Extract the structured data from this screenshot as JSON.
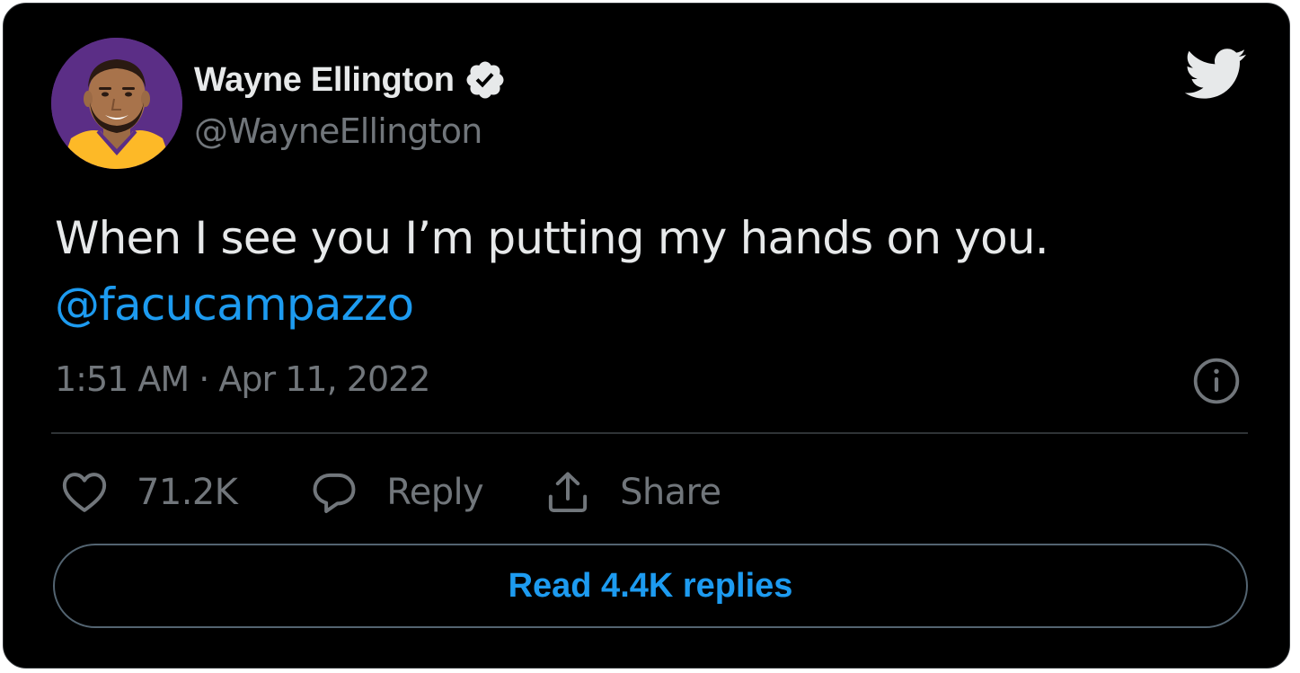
{
  "author": {
    "display_name": "Wayne Ellington",
    "handle": "@WayneEllington",
    "verified": true
  },
  "tweet": {
    "text": "When I see you I’m putting my hands on you.",
    "mention": "@facucampazzo",
    "timestamp": "1:51 AM · Apr 11, 2022"
  },
  "actions": {
    "like_count": "71.2K",
    "reply_label": "Reply",
    "share_label": "Share"
  },
  "read_replies_label": "Read 4.4K replies",
  "icons": {
    "verified": "verified-badge-icon",
    "brand": "twitter-bird-icon",
    "info": "info-icon",
    "like": "heart-icon",
    "reply": "speech-bubble-icon",
    "share": "share-upload-icon"
  },
  "colors": {
    "background": "#000000",
    "text": "#e7e9ea",
    "secondary": "#71767b",
    "accent": "#1d9bf0",
    "avatar_bg": "#5b2e86",
    "jersey": "#fdb927"
  }
}
